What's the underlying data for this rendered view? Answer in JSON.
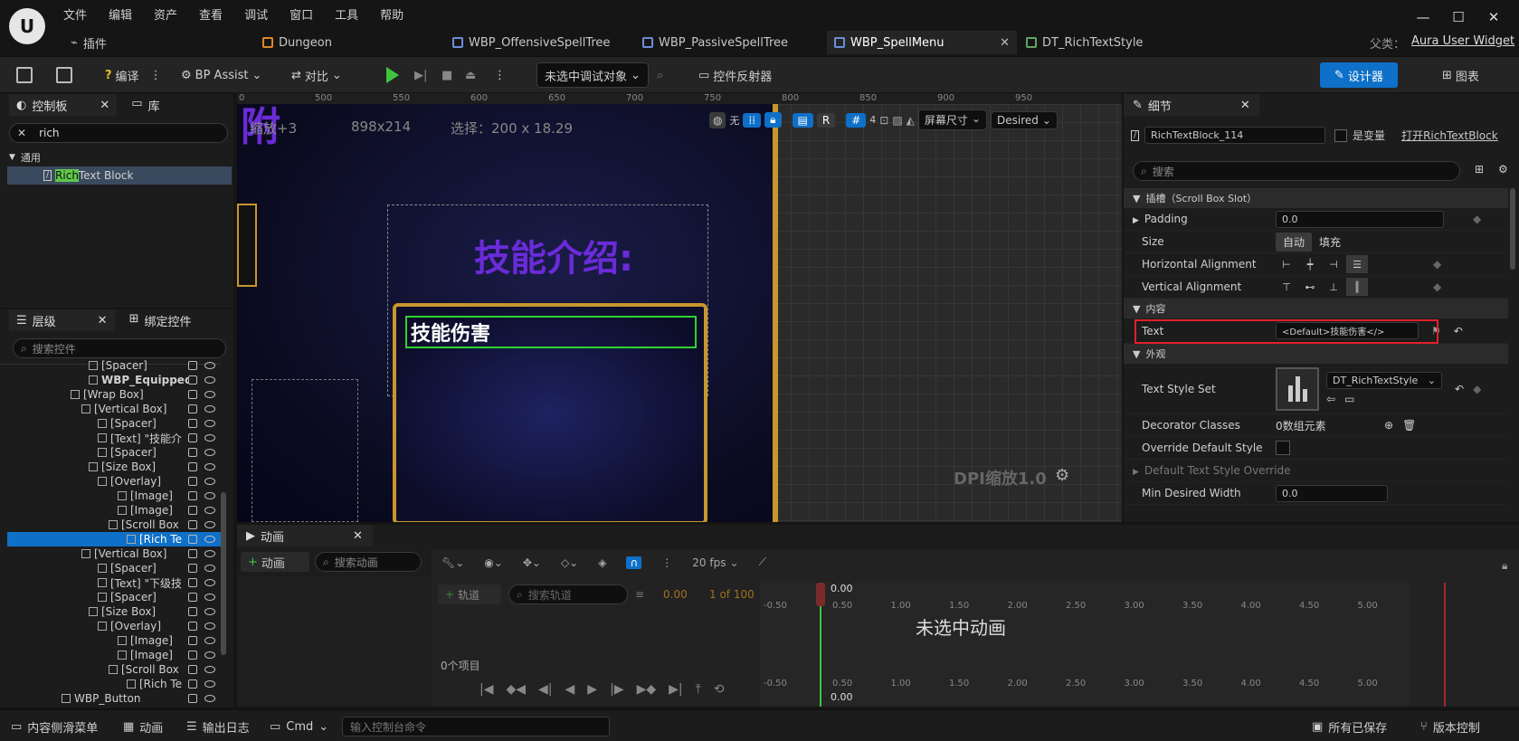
{
  "app": {
    "menus": [
      "文件",
      "编辑",
      "资产",
      "查看",
      "调试",
      "窗口",
      "工具",
      "帮助"
    ],
    "plugin_label": "插件",
    "tabs": [
      "Dungeon",
      "WBP_OffensiveSpellTree",
      "WBP_PassiveSpellTree",
      "WBP_SpellMenu",
      "DT_RichTextStyle"
    ],
    "parent_label": "父类：",
    "parent_value": "Aura User Widget",
    "window_buttons": {
      "min": "—",
      "max": "☐",
      "close": "✕"
    }
  },
  "toolbar": {
    "compile": "编译",
    "bp_assist": "BP Assist",
    "diff": "对比",
    "debug_object": "未选中调试对象",
    "widget_reflector": "控件反射器",
    "designer": "设计器",
    "graph": "图表"
  },
  "palette": {
    "title": "控制板",
    "library": "库",
    "search_value": "rich",
    "category": "通用",
    "item_highlight": "Rich",
    "item_rest": " Text Block"
  },
  "hierarchy": {
    "title": "层级",
    "bind_title": "绑定控件",
    "search_placeholder": "搜索控件",
    "rows": [
      {
        "label": "[Spacer]",
        "indent": 90
      },
      {
        "label": "WBP_EquippedS",
        "indent": 90,
        "bold": true
      },
      {
        "label": "[Wrap Box]",
        "indent": 70
      },
      {
        "label": "[Vertical Box]",
        "indent": 82
      },
      {
        "label": "[Spacer]",
        "indent": 100
      },
      {
        "label": "[Text] \"技能介",
        "indent": 100
      },
      {
        "label": "[Spacer]",
        "indent": 100
      },
      {
        "label": "[Size Box]",
        "indent": 90
      },
      {
        "label": "[Overlay]",
        "indent": 100
      },
      {
        "label": "[Image]",
        "indent": 122
      },
      {
        "label": "[Image]",
        "indent": 122
      },
      {
        "label": "[Scroll Box",
        "indent": 112
      },
      {
        "label": "[Rich Te",
        "indent": 132,
        "selected": true
      },
      {
        "label": "[Vertical Box]",
        "indent": 82
      },
      {
        "label": "[Spacer]",
        "indent": 100
      },
      {
        "label": "[Text] \"下级技",
        "indent": 100
      },
      {
        "label": "[Spacer]",
        "indent": 100
      },
      {
        "label": "[Size Box]",
        "indent": 90
      },
      {
        "label": "[Overlay]",
        "indent": 100
      },
      {
        "label": "[Image]",
        "indent": 122
      },
      {
        "label": "[Image]",
        "indent": 122
      },
      {
        "label": "[Scroll Box",
        "indent": 112
      },
      {
        "label": "[Rich Te",
        "indent": 132
      },
      {
        "label": "WBP_Button",
        "indent": 60
      }
    ]
  },
  "designer": {
    "zoom_text": "缩放+3",
    "resolution": "898x214",
    "selection": "选择：200 x 18.29",
    "ruler_ticks": [
      "0",
      "500",
      "550",
      "600",
      "650",
      "700",
      "750",
      "800",
      "850",
      "900",
      "950"
    ],
    "heading_text": "技能介绍:",
    "rich_text": "技能伤害",
    "world_label": "无",
    "r_label": "R",
    "grid_count": "4",
    "screen_size": "屏幕尺寸",
    "desired": "Desired",
    "dpi": "DPI缩放1.0"
  },
  "details": {
    "title": "细节",
    "widget_name": "RichTextBlock_114",
    "is_variable": "是变量",
    "open_link": "打开RichTextBlock",
    "search_placeholder": "搜索",
    "slot_section": "插槽（Scroll Box Slot）",
    "padding_label": "Padding",
    "padding_value": "0.0",
    "size_label": "Size",
    "size_auto": "自动",
    "size_fill": "填充",
    "halign_label": "Horizontal Alignment",
    "valign_label": "Vertical Alignment",
    "content_section": "内容",
    "text_label": "Text",
    "text_value": "<Default>技能伤害</>",
    "appearance_section": "外观",
    "text_style_label": "Text Style Set",
    "text_style_value": "DT_RichTextStyle",
    "decorator_label": "Decorator Classes",
    "decorator_value": "0数组元素",
    "override_label": "Override Default Style",
    "default_override_label": "Default Text Style Override",
    "min_width_label": "Min Desired Width",
    "min_width_value": "0.0"
  },
  "animation": {
    "title": "动画",
    "add_anim": "动画",
    "search_anim": "搜索动画",
    "fps": "20 fps",
    "add_track": "轨道",
    "search_track": "搜索轨道",
    "current_time": "0.00",
    "frame_info": "1 of 100",
    "no_anim": "未选中动画",
    "item_count": "0个项目",
    "playhead": "0.00",
    "time_ticks": [
      "-0.50",
      "0.50",
      "1.00",
      "1.50",
      "2.00",
      "2.50",
      "3.00",
      "3.50",
      "4.00",
      "4.50",
      "5.00"
    ]
  },
  "status": {
    "content_drawer": "内容侧滑菜单",
    "animation": "动画",
    "output_log": "输出日志",
    "cmd": "Cmd",
    "console_placeholder": "输入控制台命令",
    "all_saved": "所有已保存",
    "version_control": "版本控制"
  },
  "colors": {
    "accent": "#0e70c8",
    "highlight_red": "#e0202a",
    "gold": "#c8962e",
    "purple_text": "#6a2bd8",
    "selection_green": "#2fd32f"
  }
}
